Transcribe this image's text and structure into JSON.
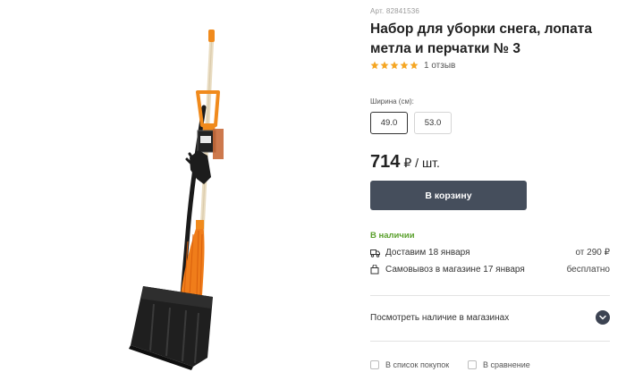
{
  "product": {
    "article": "Арт. 82841536",
    "title": "Набор для уборки снега, лопата метла и перчатки № 3",
    "rating_stars": 5,
    "reviews": "1 отзыв",
    "image_alt": "product-image-shovel-broom-gloves"
  },
  "options": {
    "width_label": "Ширина (см):",
    "sizes": [
      {
        "label": "49.0",
        "selected": true
      },
      {
        "label": "53.0",
        "selected": false
      }
    ]
  },
  "price": {
    "value": "714",
    "unit": "₽ / шт."
  },
  "actions": {
    "cart_button": "В корзину",
    "stores_link": "Посмотреть наличие в магазинах",
    "shopping_list": "В список покупок",
    "compare": "В сравнение"
  },
  "availability": {
    "status": "В наличии",
    "delivery": {
      "label": "Доставим 18 января",
      "value": "от 290 ₽"
    },
    "pickup": {
      "label": "Самовывоз в магазине 17 января",
      "value": "бесплатно"
    }
  },
  "colors": {
    "accent_button": "#454e5c",
    "in_stock": "#5aa02c",
    "star": "#f5a623"
  },
  "icons": [
    "star-icon",
    "truck-icon",
    "bag-icon",
    "chevron-down-icon",
    "checkbox-icon"
  ]
}
